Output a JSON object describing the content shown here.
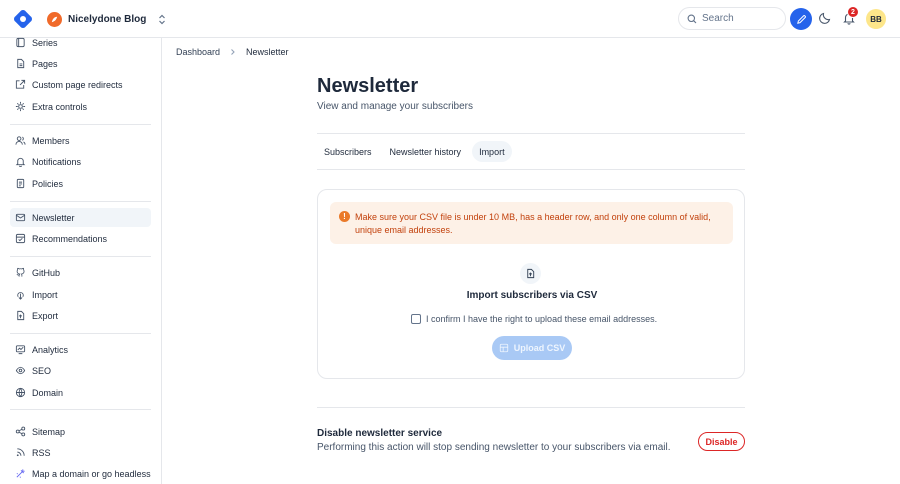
{
  "header": {
    "blog_name": "Nicelydone Blog",
    "search_placeholder": "Search",
    "notifications_count": "2",
    "user_initials": "BB",
    "brand_color": "#2563eb",
    "blog_avatar_color": "#f06a2a"
  },
  "sidebar": {
    "groups": [
      [
        {
          "label": "Series",
          "icon": "series-icon"
        },
        {
          "label": "Pages",
          "icon": "pages-icon"
        },
        {
          "label": "Custom page redirects",
          "icon": "redirect-icon"
        },
        {
          "label": "Extra controls",
          "icon": "controls-icon"
        }
      ],
      [
        {
          "label": "Members",
          "icon": "members-icon"
        },
        {
          "label": "Notifications",
          "icon": "bell-icon"
        },
        {
          "label": "Policies",
          "icon": "policy-icon"
        }
      ],
      [
        {
          "label": "Newsletter",
          "icon": "newsletter-icon",
          "active": true
        },
        {
          "label": "Recommendations",
          "icon": "recommendations-icon"
        }
      ],
      [
        {
          "label": "GitHub",
          "icon": "github-icon"
        },
        {
          "label": "Import",
          "icon": "import-icon"
        },
        {
          "label": "Export",
          "icon": "export-icon"
        }
      ],
      [
        {
          "label": "Analytics",
          "icon": "analytics-icon"
        },
        {
          "label": "SEO",
          "icon": "seo-icon"
        },
        {
          "label": "Domain",
          "icon": "globe-icon"
        }
      ],
      [
        {
          "label": "Sitemap",
          "icon": "sitemap-icon"
        },
        {
          "label": "RSS",
          "icon": "rss-icon"
        },
        {
          "label": "Map a domain or go headless",
          "icon": "headless-icon"
        }
      ]
    ]
  },
  "breadcrumb": {
    "root": "Dashboard",
    "current": "Newsletter"
  },
  "page": {
    "title": "Newsletter",
    "subtitle": "View and manage your subscribers"
  },
  "tabs": [
    {
      "label": "Subscribers",
      "active": false
    },
    {
      "label": "Newsletter history",
      "active": false
    },
    {
      "label": "Import",
      "active": true
    }
  ],
  "import_card": {
    "alert_line1": "Make sure your CSV file is under 10 MB, has a header row, and only one column of valid,",
    "alert_line2": "unique email addresses.",
    "title": "Import subscribers via CSV",
    "confirm_label": "I confirm I have the right to upload these email addresses.",
    "upload_label": "Upload CSV"
  },
  "disable_section": {
    "title": "Disable newsletter service",
    "description": "Performing this action will stop sending newsletter to your subscribers via email.",
    "button_label": "Disable",
    "danger_color": "#dc2626"
  }
}
